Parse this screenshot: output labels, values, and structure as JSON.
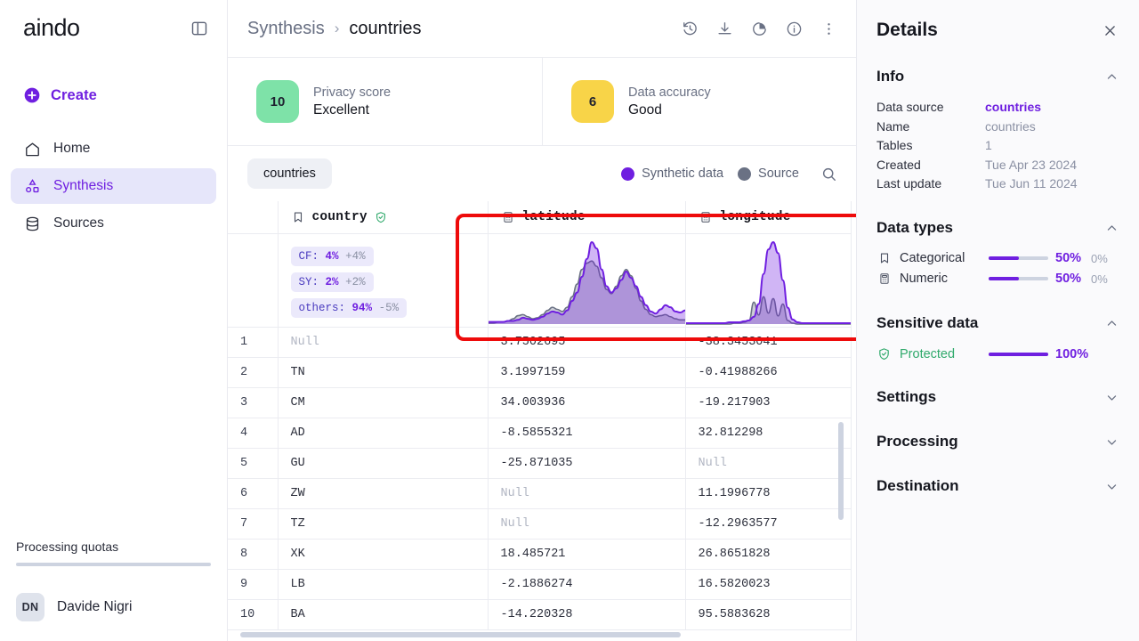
{
  "sidebar": {
    "logo": "aindo",
    "panel_toggle_icon": "panel-collapse-icon",
    "create_label": "Create",
    "items": [
      {
        "label": "Home",
        "icon": "home-icon",
        "active": false
      },
      {
        "label": "Synthesis",
        "icon": "synthesis-icon",
        "active": true
      },
      {
        "label": "Sources",
        "icon": "database-icon",
        "active": false
      }
    ],
    "quota_label": "Processing quotas",
    "user": {
      "initials": "DN",
      "name": "Davide Nigri"
    }
  },
  "header": {
    "breadcrumb_parent": "Synthesis",
    "breadcrumb_sep": "›",
    "breadcrumb_current": "countries",
    "actions": [
      {
        "icon": "history-icon",
        "name": "history-button"
      },
      {
        "icon": "download-icon",
        "name": "download-button"
      },
      {
        "icon": "pie-chart-icon",
        "name": "report-button"
      },
      {
        "icon": "info-icon",
        "name": "info-button"
      },
      {
        "icon": "more-vertical-icon",
        "name": "more-button"
      }
    ]
  },
  "scores": [
    {
      "value": "10",
      "title": "Privacy score",
      "label": "Excellent",
      "color": "#7ee2a8"
    },
    {
      "value": "6",
      "title": "Data accuracy",
      "label": "Good",
      "color": "#f8d448"
    }
  ],
  "toolbar": {
    "tab_label": "countries",
    "legend": [
      {
        "label": "Synthetic data",
        "color": "#6f1fe0"
      },
      {
        "label": "Source",
        "color": "#6a7184"
      }
    ],
    "search_icon": "search-icon"
  },
  "table": {
    "columns": [
      {
        "key": "idx",
        "label": "",
        "icon": ""
      },
      {
        "key": "country",
        "label": "country",
        "icon": "categorical-icon",
        "protected": true
      },
      {
        "key": "latitude",
        "label": "latitude",
        "icon": "numeric-icon",
        "protected": false
      },
      {
        "key": "longitude",
        "label": "longitude",
        "icon": "numeric-icon",
        "protected": false
      }
    ],
    "country_stats": [
      {
        "key": "CF:",
        "value": "4%",
        "delta": "+4%"
      },
      {
        "key": "SY:",
        "value": "2%",
        "delta": "+2%"
      },
      {
        "key": "others:",
        "value": "94%",
        "delta": "-5%"
      }
    ],
    "rows": [
      {
        "idx": "1",
        "country": "Null",
        "latitude": "3.7502695",
        "longitude": "-38.3453041"
      },
      {
        "idx": "2",
        "country": "TN",
        "latitude": "3.1997159",
        "longitude": "-0.41988266"
      },
      {
        "idx": "3",
        "country": "CM",
        "latitude": "34.003936",
        "longitude": "-19.217903"
      },
      {
        "idx": "4",
        "country": "AD",
        "latitude": "-8.5855321",
        "longitude": "32.812298"
      },
      {
        "idx": "5",
        "country": "GU",
        "latitude": "-25.871035",
        "longitude": "Null"
      },
      {
        "idx": "6",
        "country": "ZW",
        "latitude": "Null",
        "longitude": "11.1996778"
      },
      {
        "idx": "7",
        "country": "TZ",
        "latitude": "Null",
        "longitude": "-12.2963577"
      },
      {
        "idx": "8",
        "country": "XK",
        "latitude": "18.485721",
        "longitude": "26.8651828"
      },
      {
        "idx": "9",
        "country": "LB",
        "latitude": "-2.1886274",
        "longitude": "16.5820023"
      },
      {
        "idx": "10",
        "country": "BA",
        "latitude": "-14.220328",
        "longitude": "95.5883628"
      }
    ]
  },
  "chart_data": [
    {
      "type": "area",
      "title": "latitude",
      "series": [
        {
          "name": "Synthetic data",
          "color": "#6f1fe0",
          "values": [
            2,
            2,
            2,
            2,
            3,
            3,
            4,
            6,
            5,
            4,
            5,
            7,
            10,
            12,
            11,
            9,
            13,
            22,
            30,
            45,
            62,
            78,
            72,
            52,
            36,
            30,
            34,
            42,
            50,
            44,
            36,
            26,
            18,
            12,
            10,
            14,
            18,
            16,
            12,
            11,
            13
          ]
        },
        {
          "name": "Source",
          "color": "#6a7184",
          "values": [
            1,
            1,
            2,
            2,
            3,
            5,
            8,
            9,
            7,
            5,
            6,
            9,
            13,
            16,
            14,
            12,
            16,
            26,
            38,
            52,
            58,
            60,
            55,
            44,
            33,
            29,
            36,
            46,
            52,
            46,
            34,
            22,
            14,
            9,
            7,
            8,
            9,
            7,
            5,
            4,
            4
          ]
        }
      ],
      "xlabel": "",
      "ylabel": "",
      "grid": false,
      "legend": "top"
    },
    {
      "type": "area",
      "title": "longitude",
      "series": [
        {
          "name": "Synthetic data",
          "color": "#6f1fe0",
          "values": [
            1,
            1,
            1,
            1,
            1,
            1,
            1,
            1,
            1,
            2,
            2,
            2,
            3,
            4,
            8,
            22,
            55,
            82,
            90,
            78,
            48,
            18,
            5,
            2,
            1,
            1,
            1,
            1,
            1,
            1,
            1,
            1,
            1,
            1,
            1
          ]
        },
        {
          "name": "Source",
          "color": "#6a7184",
          "values": [
            0,
            0,
            0,
            0,
            0,
            0,
            0,
            0,
            0,
            0,
            1,
            1,
            2,
            4,
            24,
            10,
            30,
            12,
            28,
            9,
            22,
            4,
            1,
            0,
            0,
            0,
            0,
            0,
            0,
            0,
            0,
            0,
            0,
            0,
            0
          ]
        }
      ],
      "xlabel": "",
      "ylabel": "",
      "grid": false,
      "legend": "top"
    }
  ],
  "details": {
    "title": "Details",
    "close_icon": "close-icon",
    "info": {
      "section": "Info",
      "rows": [
        {
          "key": "Data source",
          "value": "countries",
          "link": true
        },
        {
          "key": "Name",
          "value": "countries",
          "link": false
        },
        {
          "key": "Tables",
          "value": "1",
          "link": false
        },
        {
          "key": "Created",
          "value": "Tue Apr 23 2024",
          "link": false
        },
        {
          "key": "Last update",
          "value": "Tue Jun 11 2024",
          "link": false
        }
      ]
    },
    "data_types": {
      "section": "Data types",
      "rows": [
        {
          "icon": "categorical-icon",
          "label": "Categorical",
          "pct": "50%",
          "sub": "0%",
          "fill": 50
        },
        {
          "icon": "numeric-icon",
          "label": "Numeric",
          "pct": "50%",
          "sub": "0%",
          "fill": 50
        }
      ]
    },
    "sensitive": {
      "section": "Sensitive data",
      "label": "Protected",
      "pct": "100%",
      "fill": 100
    },
    "collapsed_sections": [
      {
        "label": "Settings"
      },
      {
        "label": "Processing"
      },
      {
        "label": "Destination"
      }
    ]
  },
  "annotation": {
    "highlight_color": "#ee0b0b"
  }
}
